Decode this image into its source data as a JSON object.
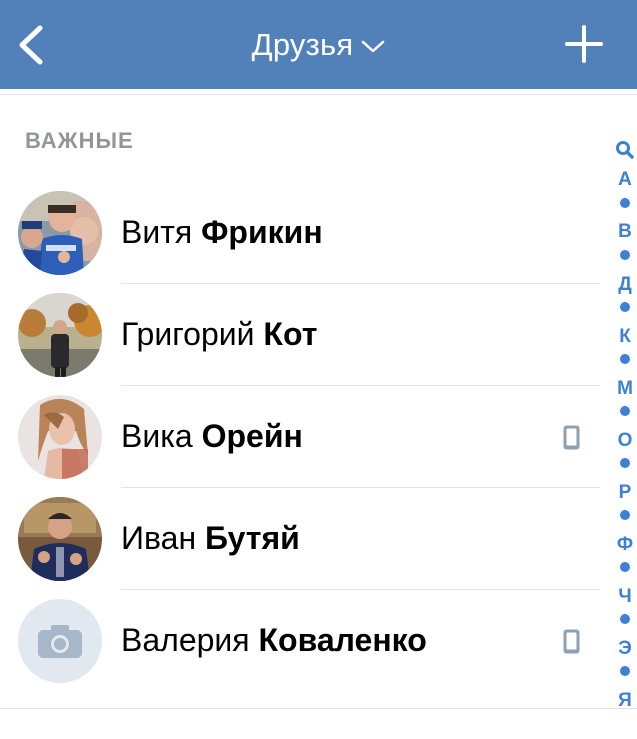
{
  "navbar": {
    "title": "Друзья",
    "back_icon": "chevron-left-icon",
    "dropdown_icon": "chevron-down-icon",
    "add_icon": "plus-icon",
    "bg_color": "#5181b8"
  },
  "section": {
    "title": "ВАЖНЫЕ"
  },
  "friends": [
    {
      "first": "Витя",
      "last": "Фрикин",
      "avatar": "photo",
      "mobile": false
    },
    {
      "first": "Григорий",
      "last": "Кот",
      "avatar": "photo",
      "mobile": false
    },
    {
      "first": "Вика",
      "last": "Орейн",
      "avatar": "photo",
      "mobile": true
    },
    {
      "first": "Иван",
      "last": "Бутяй",
      "avatar": "photo",
      "mobile": false
    },
    {
      "first": "Валерия",
      "last": "Коваленко",
      "avatar": "camera-placeholder-icon",
      "mobile": true
    }
  ],
  "index": {
    "search_icon": "search-icon",
    "letters": [
      "А",
      "В",
      "Д",
      "К",
      "М",
      "О",
      "Р",
      "Ф",
      "Ч",
      "Э",
      "Я"
    ],
    "accent_color": "#3e81d2"
  }
}
